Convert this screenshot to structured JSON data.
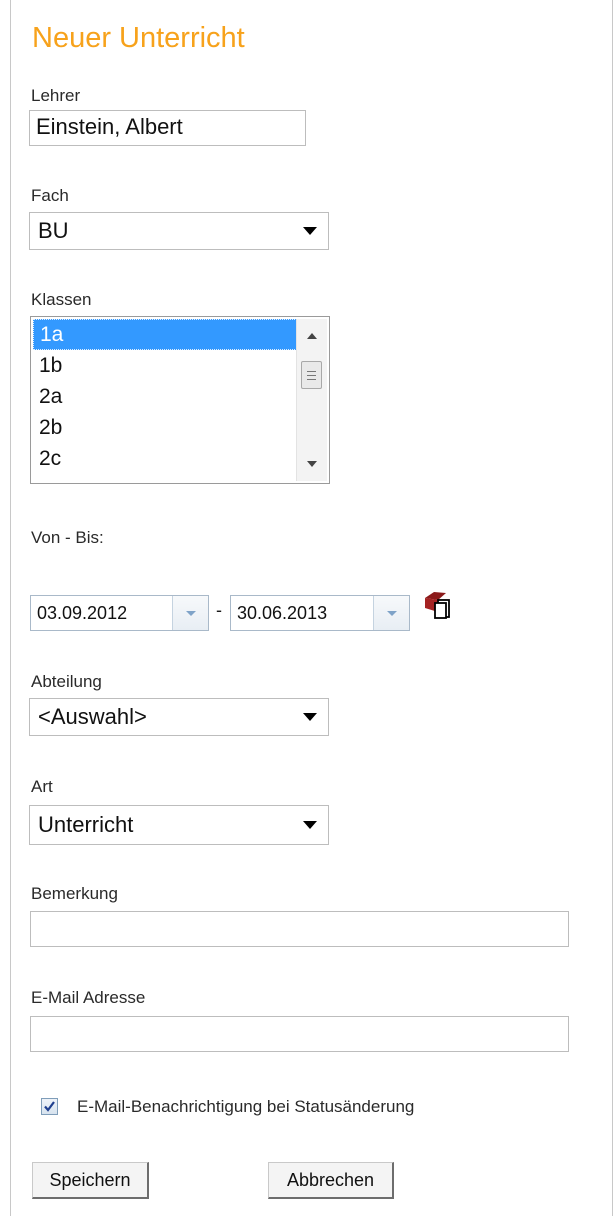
{
  "form": {
    "title": "Neuer Unterricht",
    "lehrer": {
      "label": "Lehrer",
      "value": "Einstein, Albert"
    },
    "fach": {
      "label": "Fach",
      "value": "BU"
    },
    "klassen": {
      "label": "Klassen",
      "items": [
        "1a",
        "1b",
        "2a",
        "2b",
        "2c"
      ],
      "selected": "1a"
    },
    "von_bis": {
      "label": "Von - Bis:",
      "from": "03.09.2012",
      "separator": "-",
      "to": "30.06.2013"
    },
    "abteilung": {
      "label": "Abteilung",
      "value": "<Auswahl>"
    },
    "art": {
      "label": "Art",
      "value": "Unterricht"
    },
    "bemerkung": {
      "label": "Bemerkung",
      "value": ""
    },
    "email": {
      "label": "E-Mail Adresse",
      "value": ""
    },
    "notify": {
      "label": "E-Mail-Benachrichtigung bei Statusänderung",
      "checked": true
    },
    "buttons": {
      "save": "Speichern",
      "cancel": "Abbrechen"
    }
  },
  "colors": {
    "title": "#f7a21b",
    "selection": "#3399ff",
    "calendar_icon": "#8b1a1a"
  },
  "icons": {
    "calendar": "calendar-copy-icon",
    "check": "check-icon"
  }
}
